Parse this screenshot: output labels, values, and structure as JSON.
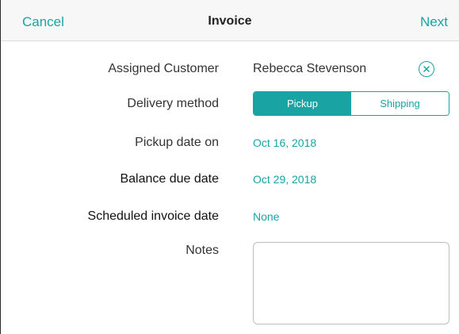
{
  "nav": {
    "cancel_label": "Cancel",
    "title": "Invoice",
    "next_label": "Next"
  },
  "form": {
    "assigned_customer": {
      "label": "Assigned Customer",
      "value": "Rebecca Stevenson",
      "clear_icon": "close-circle-icon"
    },
    "delivery_method": {
      "label": "Delivery method",
      "options": [
        "Pickup",
        "Shipping"
      ],
      "selected": "Pickup"
    },
    "pickup_date": {
      "label": "Pickup date on",
      "value": "Oct 16, 2018"
    },
    "balance_due_date": {
      "label": "Balance due date",
      "value": "Oct 29, 2018"
    },
    "scheduled_invoice_date": {
      "label": "Scheduled invoice date",
      "value": "None"
    },
    "notes": {
      "label": "Notes",
      "value": ""
    }
  },
  "colors": {
    "accent": "#1aa3a3",
    "text": "#333333",
    "navbar_bg": "#f7f7f7"
  }
}
